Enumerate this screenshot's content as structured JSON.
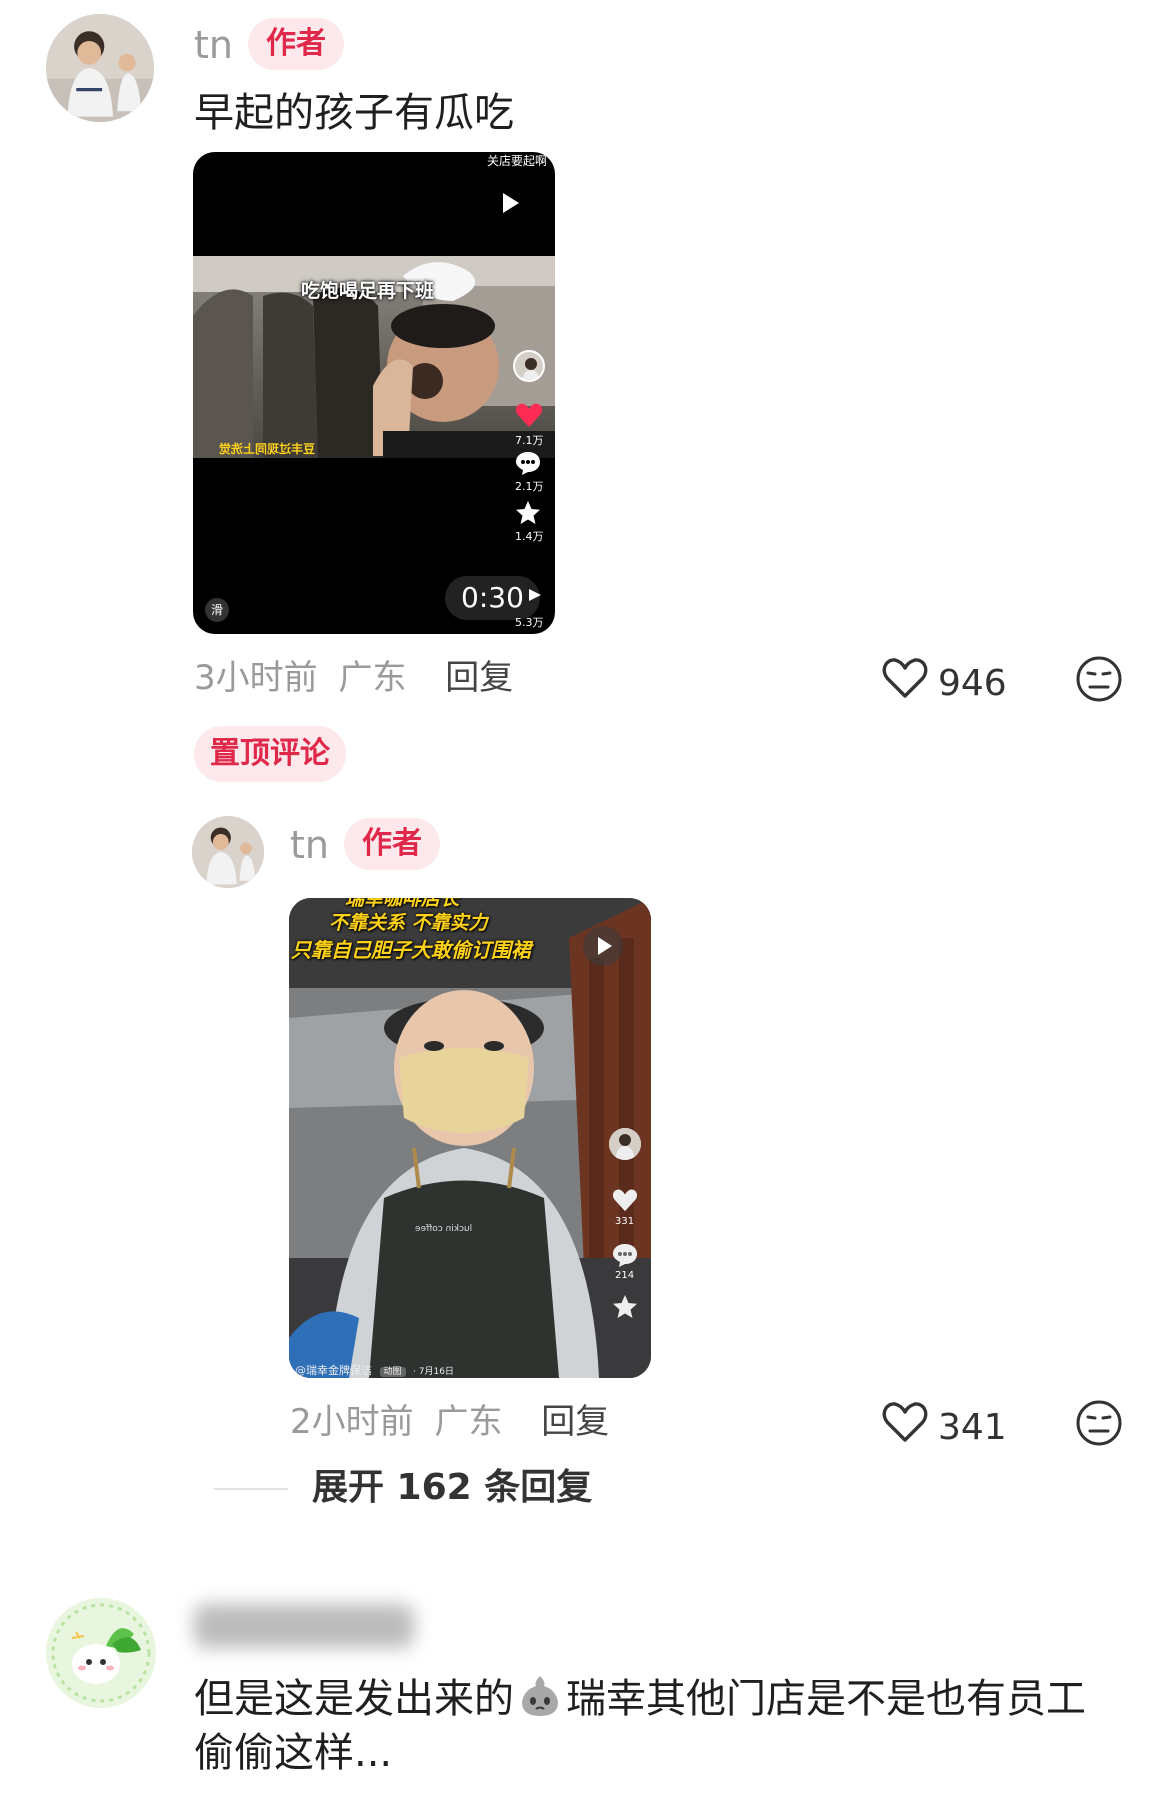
{
  "comment1": {
    "username": "tn",
    "badge": "作者",
    "text": "早起的孩子有瓜吃",
    "video": {
      "top_caption": "关店要起啊",
      "scene_caption": "吃饱喝足再下班",
      "mirror_caption": "豆丰过现同上洗觉",
      "likes": "7.1万",
      "comments": "2.1万",
      "stars": "1.4万",
      "shares": "5.3万",
      "duration": "0:30",
      "watermark": "滑"
    },
    "time": "3小时前",
    "location": "广东",
    "reply_label": "回复",
    "like_count": "946"
  },
  "pinned_label": "置顶评论",
  "reply1": {
    "username": "tn",
    "badge": "作者",
    "video": {
      "caption_line0": "瑞幸咖啡店长",
      "caption_line1": "不靠关系 不靠实力",
      "caption_line2": "只靠自己胆子大敢偷订围裙",
      "apron_text": "luckin coffee",
      "likes": "331",
      "comments": "214",
      "footer": "@瑞幸金牌保洁",
      "footer_tag": "动图",
      "footer_date": "· 7月16日"
    },
    "time": "2小时前",
    "location": "广东",
    "reply_label": "回复",
    "like_count": "341"
  },
  "expand_label": "展开 162 条回复",
  "comment2": {
    "text_part1": "但是这是发出来的",
    "text_part2": "瑞幸其他门店是不是也有员工偷偷这样..."
  },
  "colors": {
    "accent_red": "#e0284a",
    "badge_bg": "#fde8ec",
    "meta_gray": "#9a9a9a"
  },
  "icons": [
    "play-icon",
    "heart-icon",
    "comment-bubble-icon",
    "star-icon",
    "share-arrow-icon",
    "dislike-face-icon",
    "emoji-icon"
  ]
}
